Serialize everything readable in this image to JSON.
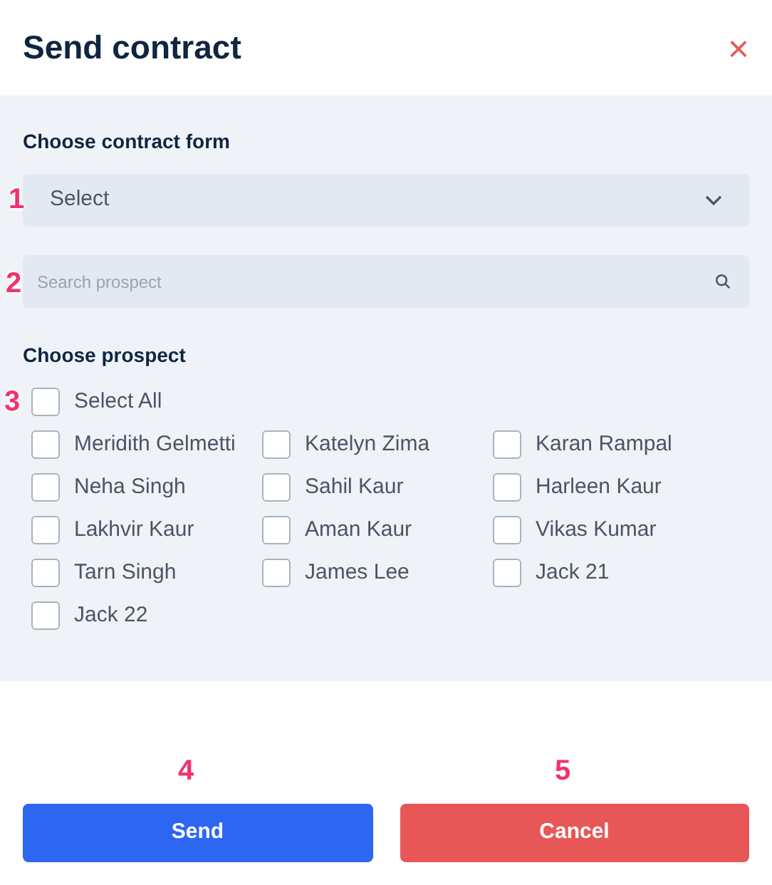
{
  "dialog": {
    "title": "Send contract",
    "close_label": "×"
  },
  "contract_form": {
    "label": "Choose contract form",
    "value": "Select",
    "annotation": "1"
  },
  "search": {
    "placeholder": "Search prospect",
    "annotation": "2"
  },
  "prospects": {
    "label": "Choose prospect",
    "select_all": {
      "label": "Select All",
      "checked": false,
      "annotation": "3"
    },
    "items": [
      {
        "name": "Meridith Gelmetti",
        "checked": false
      },
      {
        "name": "Katelyn Zima",
        "checked": false
      },
      {
        "name": "Karan Rampal",
        "checked": false
      },
      {
        "name": "Neha Singh",
        "checked": false
      },
      {
        "name": "Sahil Kaur",
        "checked": false
      },
      {
        "name": "Harleen Kaur",
        "checked": false
      },
      {
        "name": "Lakhvir Kaur",
        "checked": false
      },
      {
        "name": "Aman Kaur",
        "checked": false
      },
      {
        "name": "Vikas Kumar",
        "checked": false
      },
      {
        "name": "Tarn Singh",
        "checked": false
      },
      {
        "name": "James Lee",
        "checked": false
      },
      {
        "name": "Jack 21",
        "checked": false
      },
      {
        "name": "Jack 22",
        "checked": false
      }
    ]
  },
  "buttons": [
    {
      "label": "Send",
      "kind": "primary",
      "annotation": "4"
    },
    {
      "label": "Cancel",
      "kind": "danger",
      "annotation": "5"
    }
  ]
}
